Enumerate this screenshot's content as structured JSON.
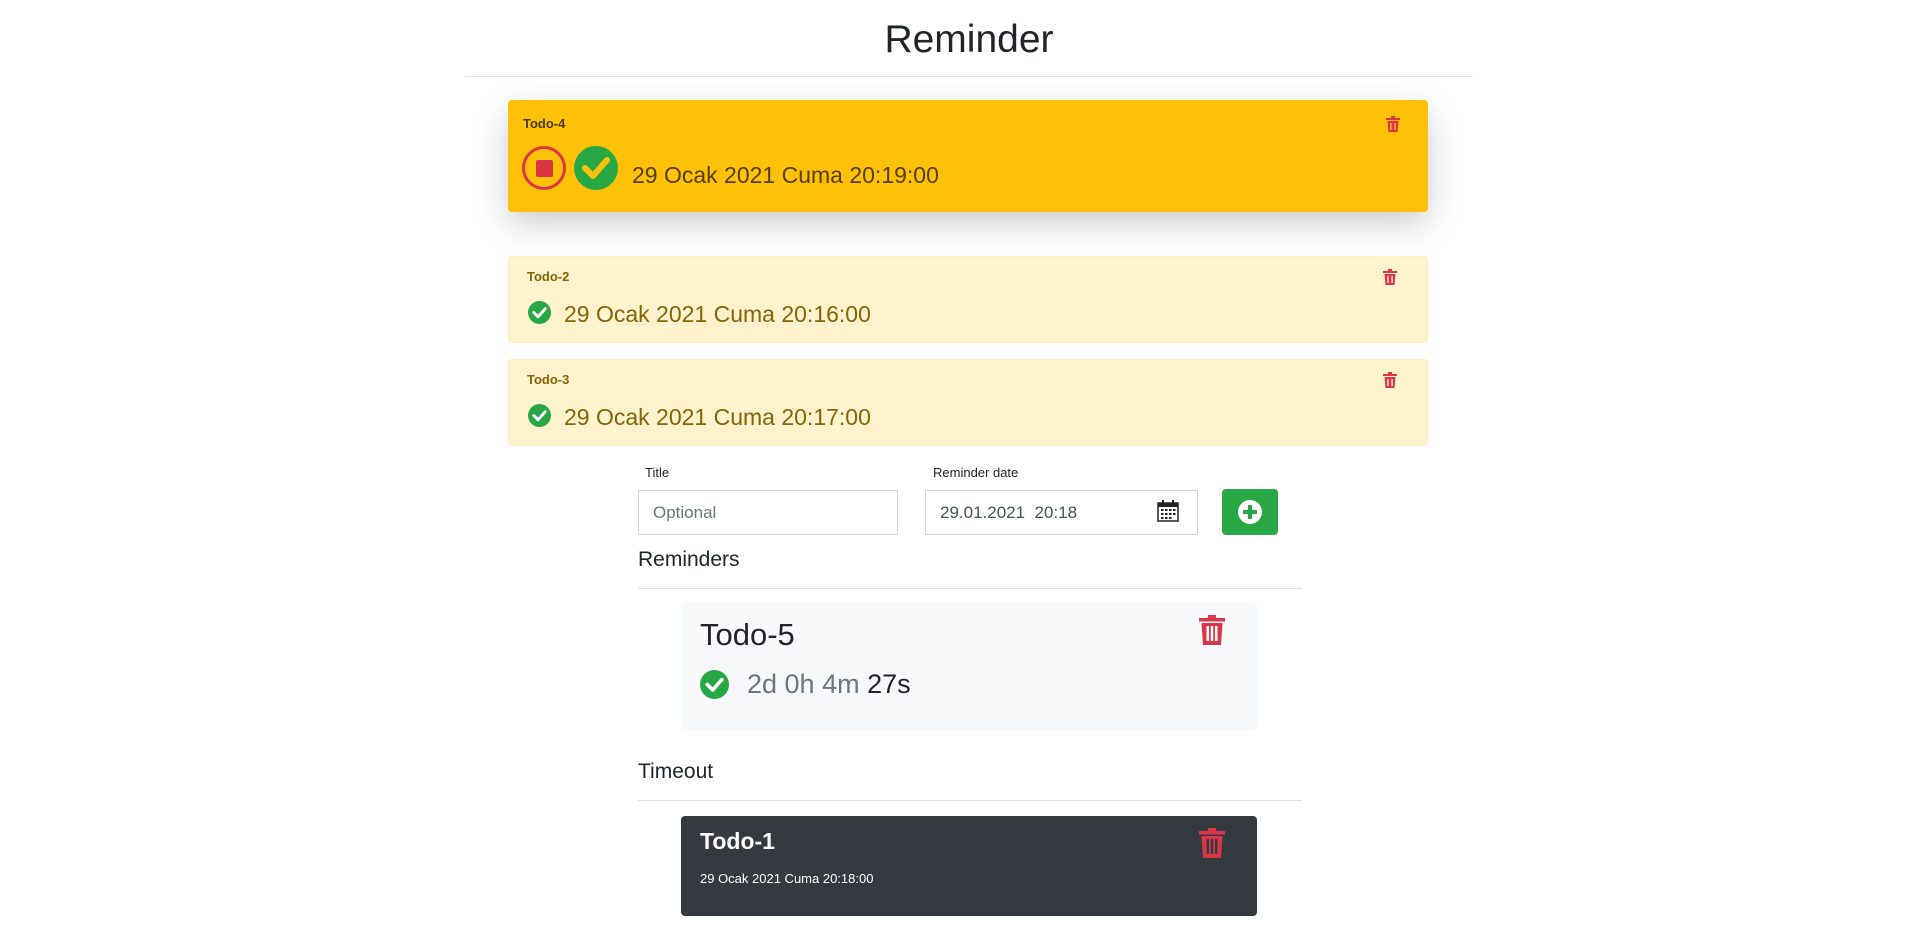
{
  "page": {
    "title": "Reminder"
  },
  "active_alert": {
    "title": "Todo-4",
    "date": "29 Ocak 2021 Cuma 20:19:00"
  },
  "upcoming_alerts": [
    {
      "title": "Todo-2",
      "date": "29 Ocak 2021 Cuma 20:16:00"
    },
    {
      "title": "Todo-3",
      "date": "29 Ocak 2021 Cuma 20:17:00"
    }
  ],
  "form": {
    "title_label": "Title",
    "title_placeholder": "Optional",
    "title_value": "",
    "date_label": "Reminder date",
    "date_value": "29.01.2021  20:18"
  },
  "reminders": {
    "heading": "Reminders",
    "items": [
      {
        "title": "Todo-5",
        "countdown_main": "2d 0h 4m",
        "countdown_seconds": "27s"
      }
    ]
  },
  "timeout": {
    "heading": "Timeout",
    "items": [
      {
        "title": "Todo-1",
        "date": "29 Ocak 2021 Cuma 20:18:00"
      }
    ]
  },
  "colors": {
    "warning": "#ffc107",
    "warning_soft": "#fff3cd",
    "success": "#28a745",
    "danger": "#dc3545",
    "dark": "#343a40",
    "light": "#f8f9fa"
  },
  "icons": {
    "stop": "stop-circle-icon",
    "check": "check-circle-icon",
    "trash": "trash-icon",
    "calendar": "calendar-icon",
    "add": "plus-circle-icon"
  }
}
